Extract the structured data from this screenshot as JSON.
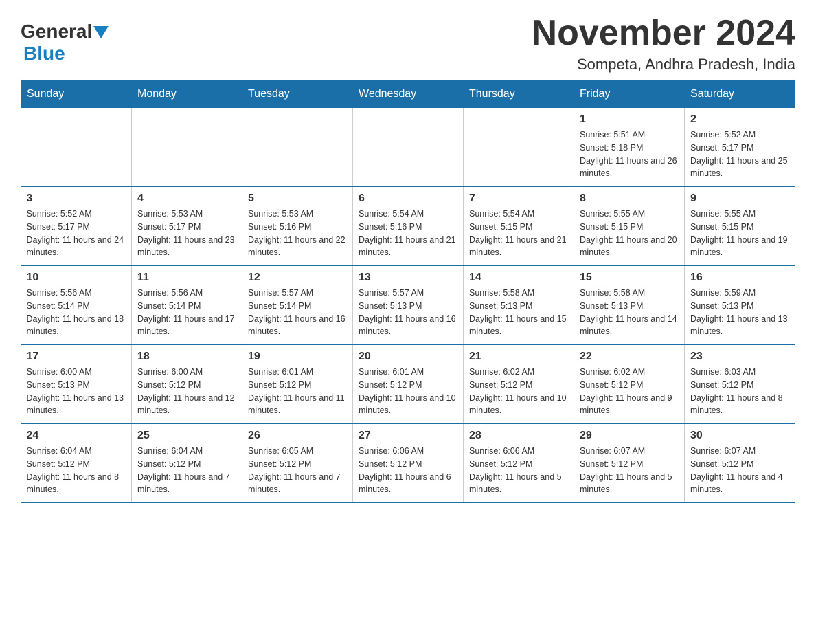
{
  "header": {
    "title": "November 2024",
    "subtitle": "Sompeta, Andhra Pradesh, India",
    "logo_general": "General",
    "logo_blue": "Blue"
  },
  "calendar": {
    "days_of_week": [
      "Sunday",
      "Monday",
      "Tuesday",
      "Wednesday",
      "Thursday",
      "Friday",
      "Saturday"
    ],
    "weeks": [
      [
        {
          "day": "",
          "sunrise": "",
          "sunset": "",
          "daylight": ""
        },
        {
          "day": "",
          "sunrise": "",
          "sunset": "",
          "daylight": ""
        },
        {
          "day": "",
          "sunrise": "",
          "sunset": "",
          "daylight": ""
        },
        {
          "day": "",
          "sunrise": "",
          "sunset": "",
          "daylight": ""
        },
        {
          "day": "",
          "sunrise": "",
          "sunset": "",
          "daylight": ""
        },
        {
          "day": "1",
          "sunrise": "Sunrise: 5:51 AM",
          "sunset": "Sunset: 5:18 PM",
          "daylight": "Daylight: 11 hours and 26 minutes."
        },
        {
          "day": "2",
          "sunrise": "Sunrise: 5:52 AM",
          "sunset": "Sunset: 5:17 PM",
          "daylight": "Daylight: 11 hours and 25 minutes."
        }
      ],
      [
        {
          "day": "3",
          "sunrise": "Sunrise: 5:52 AM",
          "sunset": "Sunset: 5:17 PM",
          "daylight": "Daylight: 11 hours and 24 minutes."
        },
        {
          "day": "4",
          "sunrise": "Sunrise: 5:53 AM",
          "sunset": "Sunset: 5:17 PM",
          "daylight": "Daylight: 11 hours and 23 minutes."
        },
        {
          "day": "5",
          "sunrise": "Sunrise: 5:53 AM",
          "sunset": "Sunset: 5:16 PM",
          "daylight": "Daylight: 11 hours and 22 minutes."
        },
        {
          "day": "6",
          "sunrise": "Sunrise: 5:54 AM",
          "sunset": "Sunset: 5:16 PM",
          "daylight": "Daylight: 11 hours and 21 minutes."
        },
        {
          "day": "7",
          "sunrise": "Sunrise: 5:54 AM",
          "sunset": "Sunset: 5:15 PM",
          "daylight": "Daylight: 11 hours and 21 minutes."
        },
        {
          "day": "8",
          "sunrise": "Sunrise: 5:55 AM",
          "sunset": "Sunset: 5:15 PM",
          "daylight": "Daylight: 11 hours and 20 minutes."
        },
        {
          "day": "9",
          "sunrise": "Sunrise: 5:55 AM",
          "sunset": "Sunset: 5:15 PM",
          "daylight": "Daylight: 11 hours and 19 minutes."
        }
      ],
      [
        {
          "day": "10",
          "sunrise": "Sunrise: 5:56 AM",
          "sunset": "Sunset: 5:14 PM",
          "daylight": "Daylight: 11 hours and 18 minutes."
        },
        {
          "day": "11",
          "sunrise": "Sunrise: 5:56 AM",
          "sunset": "Sunset: 5:14 PM",
          "daylight": "Daylight: 11 hours and 17 minutes."
        },
        {
          "day": "12",
          "sunrise": "Sunrise: 5:57 AM",
          "sunset": "Sunset: 5:14 PM",
          "daylight": "Daylight: 11 hours and 16 minutes."
        },
        {
          "day": "13",
          "sunrise": "Sunrise: 5:57 AM",
          "sunset": "Sunset: 5:13 PM",
          "daylight": "Daylight: 11 hours and 16 minutes."
        },
        {
          "day": "14",
          "sunrise": "Sunrise: 5:58 AM",
          "sunset": "Sunset: 5:13 PM",
          "daylight": "Daylight: 11 hours and 15 minutes."
        },
        {
          "day": "15",
          "sunrise": "Sunrise: 5:58 AM",
          "sunset": "Sunset: 5:13 PM",
          "daylight": "Daylight: 11 hours and 14 minutes."
        },
        {
          "day": "16",
          "sunrise": "Sunrise: 5:59 AM",
          "sunset": "Sunset: 5:13 PM",
          "daylight": "Daylight: 11 hours and 13 minutes."
        }
      ],
      [
        {
          "day": "17",
          "sunrise": "Sunrise: 6:00 AM",
          "sunset": "Sunset: 5:13 PM",
          "daylight": "Daylight: 11 hours and 13 minutes."
        },
        {
          "day": "18",
          "sunrise": "Sunrise: 6:00 AM",
          "sunset": "Sunset: 5:12 PM",
          "daylight": "Daylight: 11 hours and 12 minutes."
        },
        {
          "day": "19",
          "sunrise": "Sunrise: 6:01 AM",
          "sunset": "Sunset: 5:12 PM",
          "daylight": "Daylight: 11 hours and 11 minutes."
        },
        {
          "day": "20",
          "sunrise": "Sunrise: 6:01 AM",
          "sunset": "Sunset: 5:12 PM",
          "daylight": "Daylight: 11 hours and 10 minutes."
        },
        {
          "day": "21",
          "sunrise": "Sunrise: 6:02 AM",
          "sunset": "Sunset: 5:12 PM",
          "daylight": "Daylight: 11 hours and 10 minutes."
        },
        {
          "day": "22",
          "sunrise": "Sunrise: 6:02 AM",
          "sunset": "Sunset: 5:12 PM",
          "daylight": "Daylight: 11 hours and 9 minutes."
        },
        {
          "day": "23",
          "sunrise": "Sunrise: 6:03 AM",
          "sunset": "Sunset: 5:12 PM",
          "daylight": "Daylight: 11 hours and 8 minutes."
        }
      ],
      [
        {
          "day": "24",
          "sunrise": "Sunrise: 6:04 AM",
          "sunset": "Sunset: 5:12 PM",
          "daylight": "Daylight: 11 hours and 8 minutes."
        },
        {
          "day": "25",
          "sunrise": "Sunrise: 6:04 AM",
          "sunset": "Sunset: 5:12 PM",
          "daylight": "Daylight: 11 hours and 7 minutes."
        },
        {
          "day": "26",
          "sunrise": "Sunrise: 6:05 AM",
          "sunset": "Sunset: 5:12 PM",
          "daylight": "Daylight: 11 hours and 7 minutes."
        },
        {
          "day": "27",
          "sunrise": "Sunrise: 6:06 AM",
          "sunset": "Sunset: 5:12 PM",
          "daylight": "Daylight: 11 hours and 6 minutes."
        },
        {
          "day": "28",
          "sunrise": "Sunrise: 6:06 AM",
          "sunset": "Sunset: 5:12 PM",
          "daylight": "Daylight: 11 hours and 5 minutes."
        },
        {
          "day": "29",
          "sunrise": "Sunrise: 6:07 AM",
          "sunset": "Sunset: 5:12 PM",
          "daylight": "Daylight: 11 hours and 5 minutes."
        },
        {
          "day": "30",
          "sunrise": "Sunrise: 6:07 AM",
          "sunset": "Sunset: 5:12 PM",
          "daylight": "Daylight: 11 hours and 4 minutes."
        }
      ]
    ]
  }
}
